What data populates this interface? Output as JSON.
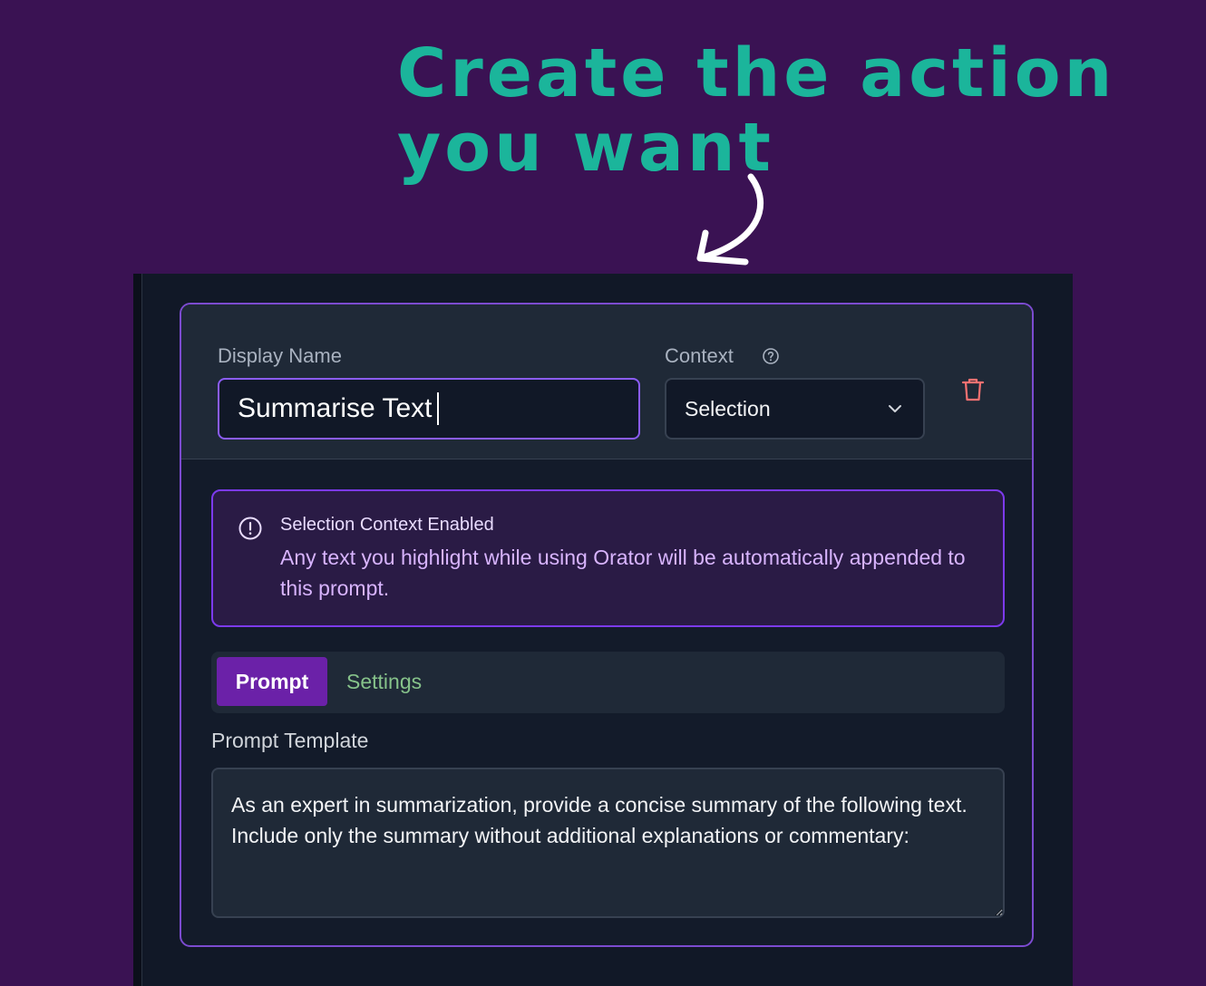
{
  "headline": {
    "line1": "Create the action",
    "line2": "you want"
  },
  "form": {
    "display_name_label": "Display Name",
    "display_name_value": "Summarise Text",
    "context_label": "Context",
    "context_value": "Selection"
  },
  "alert": {
    "title": "Selection Context Enabled",
    "body": "Any text you highlight while using Orator will be automatically appended to this prompt."
  },
  "tabs": {
    "prompt": "Prompt",
    "settings": "Settings",
    "active": "Prompt"
  },
  "prompt": {
    "template_label": "Prompt Template",
    "template_value": "As an expert in summarization, provide a concise summary of the following text. Include only the summary without additional explanations or commentary:"
  },
  "colors": {
    "background": "#3a1253",
    "headline": "#1bb59b",
    "accent": "#8b5cf6",
    "active_tab": "#6b21a8",
    "danger": "#f87171"
  },
  "icons": {
    "help": "help-circle-icon",
    "chevron": "chevron-down-icon",
    "delete": "trash-icon",
    "alert": "exclamation-circle-icon",
    "arrow": "curved-arrow-icon"
  }
}
